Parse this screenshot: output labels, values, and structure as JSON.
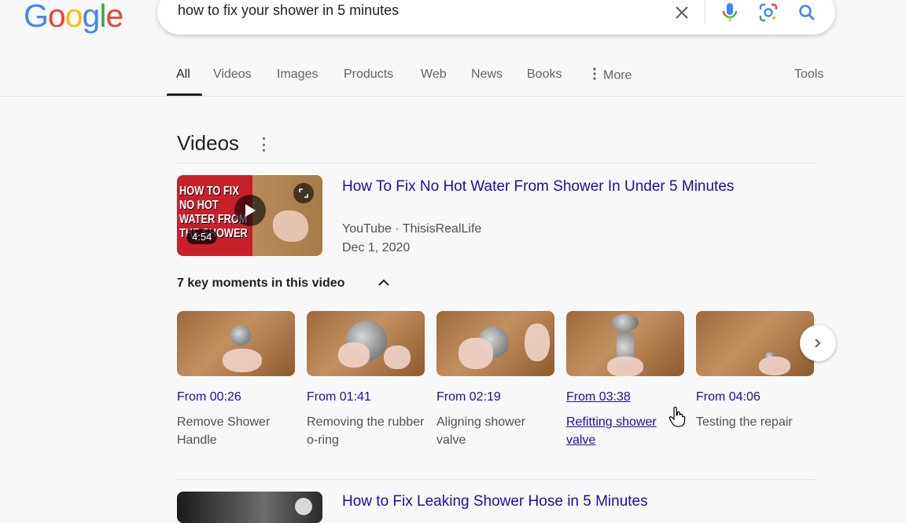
{
  "search": {
    "query": "how to fix your shower in 5 minutes"
  },
  "tabs": [
    {
      "label": "All"
    },
    {
      "label": "Videos"
    },
    {
      "label": "Images"
    },
    {
      "label": "Products"
    },
    {
      "label": "Web"
    },
    {
      "label": "News"
    },
    {
      "label": "Books"
    },
    {
      "label": "More"
    },
    {
      "label": "Tools"
    }
  ],
  "section": {
    "title": "Videos"
  },
  "video1": {
    "title": "How To Fix No Hot Water From Shower In Under 5 Minutes",
    "source": "YouTube · ThisisRealLife",
    "date": "Dec 1, 2020",
    "duration": "4:54",
    "thumb_text": "HOW TO FIX NO HOT WATER FROM THE SHOWER",
    "key_moments_title": "7 key moments in this video",
    "moments": [
      {
        "time": "From 00:26",
        "label": "Remove Shower Handle"
      },
      {
        "time": "From 01:41",
        "label": "Removing the rubber o-ring"
      },
      {
        "time": "From 02:19",
        "label": "Aligning shower valve"
      },
      {
        "time": "From 03:38",
        "label": "Refitting shower valve"
      },
      {
        "time": "From 04:06",
        "label": "Testing the repair"
      }
    ]
  },
  "video2": {
    "title": "How to Fix Leaking Shower Hose in 5 Minutes"
  },
  "colors": {
    "link": "#1a0dab",
    "text": "#202124",
    "secondary": "#4d5156",
    "background": "#f8f8f8"
  }
}
